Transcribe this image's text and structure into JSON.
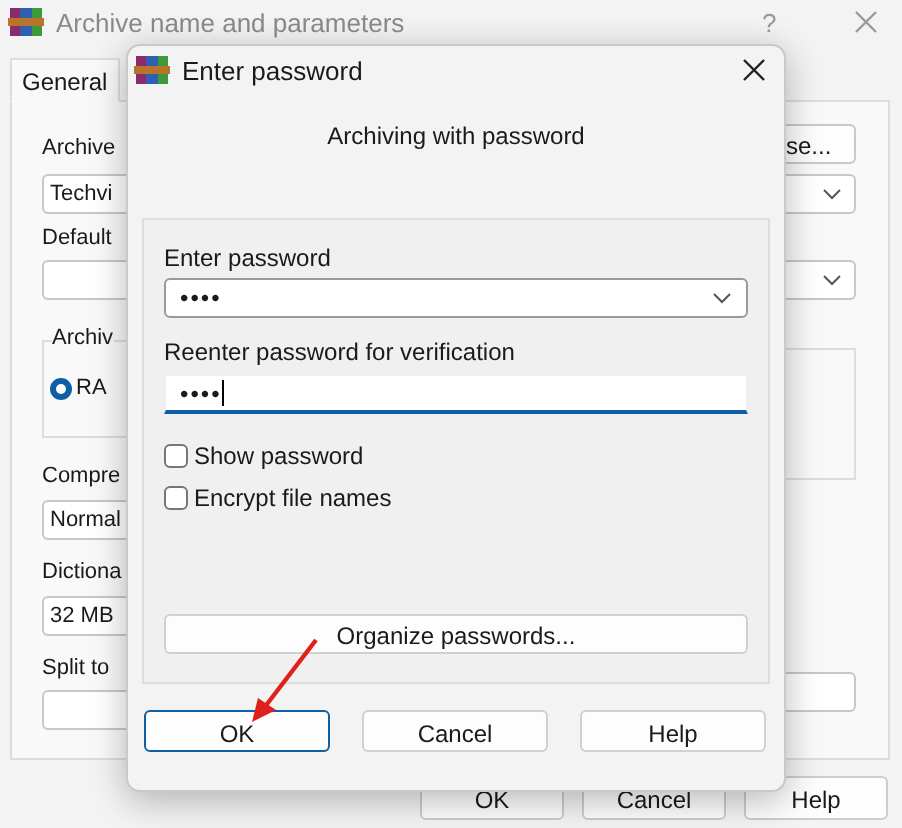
{
  "background_window": {
    "title": "Archive name and parameters",
    "help_button": "?",
    "tabs": [
      {
        "label": "General",
        "selected": true
      }
    ],
    "archive_label": "Archive",
    "archive_name": "Techvi",
    "browse_button": "se...",
    "default_label": "Default",
    "format_group": "Archiv",
    "format_option": {
      "label": "RA",
      "selected": true
    },
    "compression_label": "Compre",
    "compression_value": "Normal",
    "dictionary_label": "Dictiona",
    "dictionary_value": "32 MB",
    "split_label": "Split to",
    "buttons": [
      "OK",
      "Cancel",
      "Help"
    ]
  },
  "dialog": {
    "title": "Enter password",
    "heading": "Archiving with password",
    "password_label": "Enter password",
    "password_value": "••••",
    "reenter_label": "Reenter password for verification",
    "reenter_value": "••••",
    "reenter_focused": true,
    "checkboxes": [
      {
        "label": "Show password",
        "checked": false
      },
      {
        "label": "Encrypt file names",
        "checked": false
      }
    ],
    "organize_button": "Organize passwords...",
    "buttons": [
      {
        "label": "OK",
        "default": true
      },
      {
        "label": "Cancel",
        "default": false
      },
      {
        "label": "Help",
        "default": false
      }
    ]
  }
}
